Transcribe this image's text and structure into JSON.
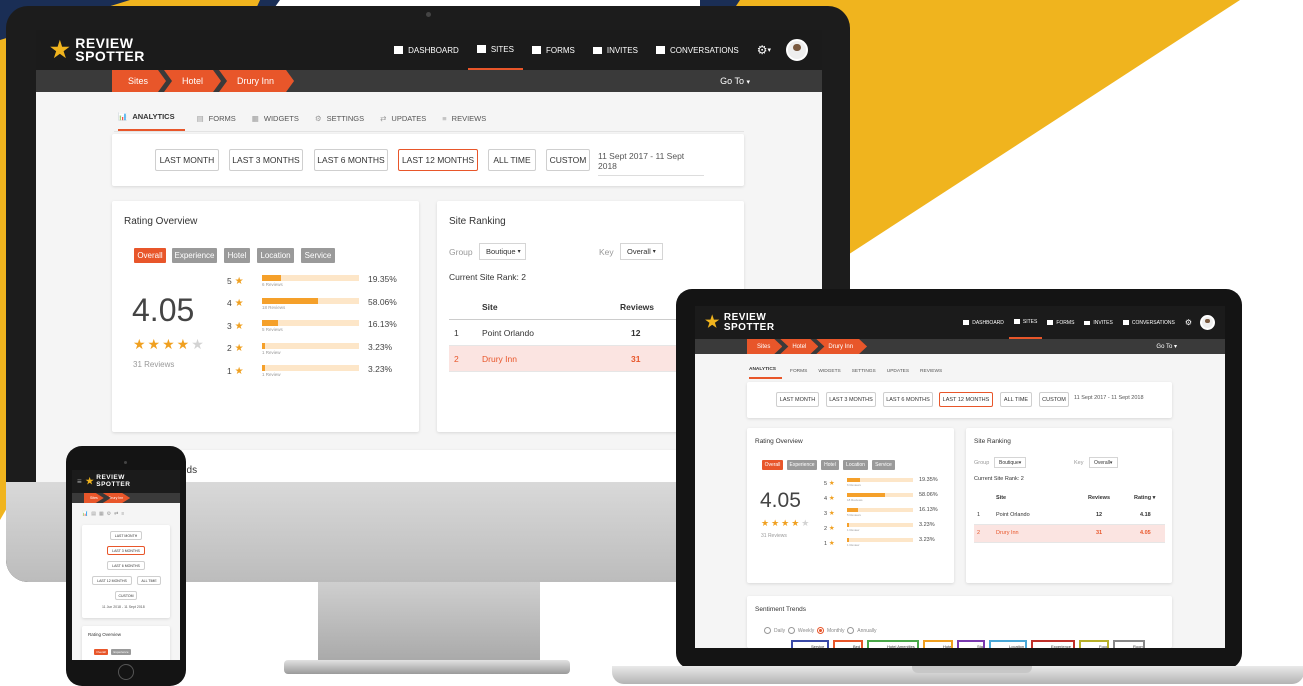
{
  "brand": {
    "logo_line1": "REVIEW",
    "logo_line2": "SPOTTER",
    "colors": {
      "accent": "#e8562a",
      "yellow": "#f0b41e",
      "navy": "#1a2e55",
      "star": "#f0a020",
      "nav_bg": "#1b1b1b",
      "crumb_bg": "#3a3a3a"
    }
  },
  "nav": {
    "items": [
      {
        "label": "DASHBOARD",
        "icon": "dashboard-icon"
      },
      {
        "label": "SITES",
        "icon": "sites-icon",
        "active": true
      },
      {
        "label": "FORMS",
        "icon": "forms-icon"
      },
      {
        "label": "INVITES",
        "icon": "invites-icon"
      },
      {
        "label": "CONVERSATIONS",
        "icon": "conversations-icon"
      }
    ],
    "settings_icon": "gear-icon",
    "avatar_icon": "user-avatar"
  },
  "breadcrumb": {
    "items": [
      "Sites",
      "Hotel",
      "Drury Inn"
    ],
    "goto": "Go To"
  },
  "tabs": [
    {
      "label": "ANALYTICS",
      "icon": "analytics-icon",
      "active": true
    },
    {
      "label": "FORMS",
      "icon": "forms-icon"
    },
    {
      "label": "WIDGETS",
      "icon": "widgets-icon"
    },
    {
      "label": "SETTINGS",
      "icon": "settings-icon"
    },
    {
      "label": "UPDATES",
      "icon": "updates-icon"
    },
    {
      "label": "REVIEWS",
      "icon": "reviews-icon"
    }
  ],
  "ranges": {
    "buttons": [
      "LAST MONTH",
      "LAST 3 MONTHS",
      "LAST 6 MONTHS",
      "LAST 12 MONTHS",
      "ALL TIME",
      "CUSTOM"
    ],
    "selected": "LAST 12 MONTHS",
    "date_range": "11 Sept 2017 - 11 Sept 2018"
  },
  "rating_overview": {
    "title": "Rating Overview",
    "filters": [
      "Overall",
      "Experience",
      "Hotel",
      "Location",
      "Service"
    ],
    "active_filter": "Overall",
    "score": "4.05",
    "stars_filled": 4,
    "reviews_count": "31 Reviews",
    "bars": [
      {
        "star": "5",
        "fraction": 0.1935,
        "sub": "6 Reviews",
        "pct": "19.35%"
      },
      {
        "star": "4",
        "fraction": 0.5806,
        "sub": "18 Reviews",
        "pct": "58.06%"
      },
      {
        "star": "3",
        "fraction": 0.1613,
        "sub": "5 Reviews",
        "pct": "16.13%"
      },
      {
        "star": "2",
        "fraction": 0.0323,
        "sub": "1 Review",
        "pct": "3.23%"
      },
      {
        "star": "1",
        "fraction": 0.0323,
        "sub": "1 Review",
        "pct": "3.23%"
      }
    ]
  },
  "site_ranking": {
    "title": "Site Ranking",
    "group_label": "Group",
    "group_value": "Boutique",
    "key_label": "Key",
    "key_value": "Overall",
    "current_rank": "Current Site Rank: 2",
    "columns": [
      "Site",
      "Reviews",
      "Rating"
    ],
    "rows": [
      {
        "rank": "1",
        "site": "Point Orlando",
        "reviews": "12",
        "rating": "4.18"
      },
      {
        "rank": "2",
        "site": "Drury Inn",
        "reviews": "31",
        "rating": "4.05",
        "highlight": true
      }
    ]
  },
  "sentiment": {
    "title": "Sentiment Trends",
    "title_partial": "nds",
    "periods": [
      "Daily",
      "Weekly",
      "Monthly",
      "Annually"
    ],
    "active_period": "Monthly",
    "legend": [
      {
        "label": "Service",
        "color": "#3a4aa8"
      },
      {
        "label": "Bed",
        "color": "#e8562a"
      },
      {
        "label": "Hotel Amenities",
        "color": "#4aa84a"
      },
      {
        "label": "Hotel",
        "color": "#f0a020"
      },
      {
        "label": "Staff",
        "color": "#7a3ab0"
      },
      {
        "label": "Location",
        "color": "#4aa8d8"
      },
      {
        "label": "Experience",
        "color": "#c0302a"
      },
      {
        "label": "Food",
        "color": "#b8b02a"
      },
      {
        "label": "Room",
        "color": "#888888"
      }
    ]
  },
  "phone": {
    "breadcrumb": [
      "Sites",
      "Drury Inn"
    ],
    "ranges": [
      "LAST MONTH",
      "LAST 3 MONTHS",
      "LAST 6 MONTHS",
      "LAST 12 MONTHS",
      "ALL TIME",
      "CUSTOM"
    ],
    "selected": "LAST 3 MONTHS",
    "date_range": "11 Jun 2018 - 11 Sept 2018",
    "rating_title": "Rating Overview",
    "filters": [
      "Overall",
      "Experience"
    ]
  }
}
